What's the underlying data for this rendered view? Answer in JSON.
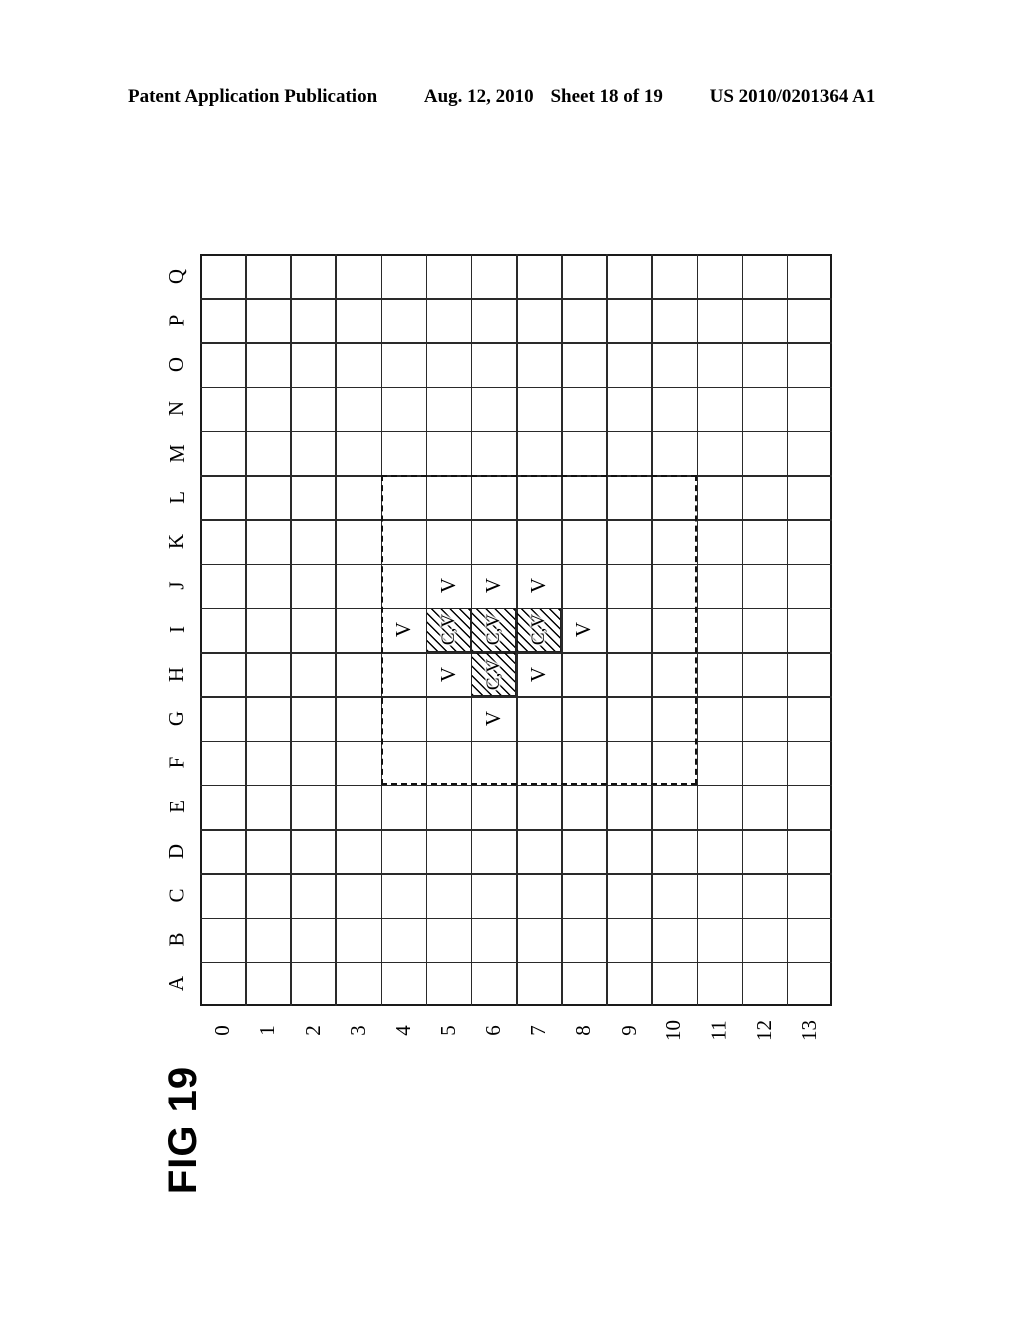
{
  "header": {
    "publication": "Patent Application Publication",
    "date": "Aug. 12, 2010",
    "sheet": "Sheet 18 of 19",
    "number": "US 2010/0201364 A1"
  },
  "figure": {
    "label": "FIG 19"
  },
  "grid": {
    "columns": 14,
    "rows": 17,
    "column_labels": [
      "0",
      "1",
      "2",
      "3",
      "4",
      "5",
      "6",
      "7",
      "8",
      "9",
      "10",
      "11",
      "12",
      "13"
    ],
    "row_labels": [
      "Q",
      "P",
      "O",
      "N",
      "M",
      "L",
      "K",
      "J",
      "I",
      "H",
      "G",
      "F",
      "E",
      "D",
      "C",
      "B",
      "A"
    ],
    "row_labels_bottom_to_top": [
      "A",
      "B",
      "C",
      "D",
      "E",
      "F",
      "G",
      "H",
      "I",
      "J",
      "K",
      "L",
      "M",
      "N",
      "O",
      "P",
      "Q"
    ]
  },
  "region": {
    "name": "dashed-search-region",
    "col_start": 4,
    "col_end": 10,
    "row_start_label": "L",
    "row_end_label": "F",
    "style": "dashed"
  },
  "marks": {
    "v_label": "V",
    "cv_label": "C,V",
    "voltage_cells": [
      {
        "col": 5,
        "row": "J",
        "label": "V"
      },
      {
        "col": 6,
        "row": "J",
        "label": "V"
      },
      {
        "col": 7,
        "row": "J",
        "label": "V"
      },
      {
        "col": 4,
        "row": "I",
        "label": "V"
      },
      {
        "col": 8,
        "row": "I",
        "label": "V"
      },
      {
        "col": 5,
        "row": "H",
        "label": "V"
      },
      {
        "col": 7,
        "row": "H",
        "label": "V"
      },
      {
        "col": 6,
        "row": "G",
        "label": "V"
      }
    ],
    "hatched_cells": [
      {
        "col": 5,
        "row": "I",
        "label": "C,V"
      },
      {
        "col": 6,
        "row": "I",
        "label": "C,V"
      },
      {
        "col": 7,
        "row": "I",
        "label": "C,V"
      },
      {
        "col": 6,
        "row": "H",
        "label": "C,V"
      }
    ]
  }
}
